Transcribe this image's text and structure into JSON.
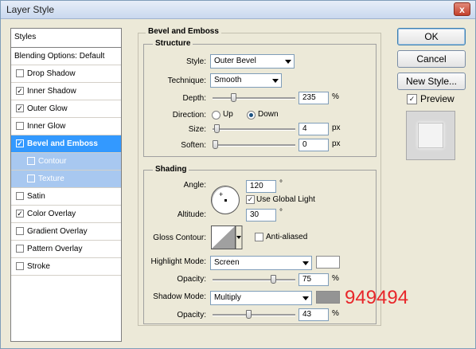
{
  "window": {
    "title": "Layer Style",
    "close_glyph": "x"
  },
  "styles_panel": {
    "header": "Styles",
    "items": [
      {
        "label": "Blending Options: Default",
        "checkbox": false,
        "checked": false,
        "state": "normal"
      },
      {
        "label": "Drop Shadow",
        "checkbox": true,
        "checked": false,
        "state": "normal"
      },
      {
        "label": "Inner Shadow",
        "checkbox": true,
        "checked": true,
        "state": "normal"
      },
      {
        "label": "Outer Glow",
        "checkbox": true,
        "checked": true,
        "state": "normal"
      },
      {
        "label": "Inner Glow",
        "checkbox": true,
        "checked": false,
        "state": "normal"
      },
      {
        "label": "Bevel and Emboss",
        "checkbox": true,
        "checked": true,
        "state": "selected"
      },
      {
        "label": "Contour",
        "checkbox": true,
        "checked": false,
        "state": "sub"
      },
      {
        "label": "Texture",
        "checkbox": true,
        "checked": false,
        "state": "sub"
      },
      {
        "label": "Satin",
        "checkbox": true,
        "checked": false,
        "state": "normal"
      },
      {
        "label": "Color Overlay",
        "checkbox": true,
        "checked": true,
        "state": "normal"
      },
      {
        "label": "Gradient Overlay",
        "checkbox": true,
        "checked": false,
        "state": "normal"
      },
      {
        "label": "Pattern Overlay",
        "checkbox": true,
        "checked": false,
        "state": "normal"
      },
      {
        "label": "Stroke",
        "checkbox": true,
        "checked": false,
        "state": "normal"
      }
    ]
  },
  "bevel": {
    "section_title": "Bevel and Emboss",
    "structure": {
      "title": "Structure",
      "style_label": "Style:",
      "style_value": "Outer Bevel",
      "technique_label": "Technique:",
      "technique_value": "Smooth",
      "depth_label": "Depth:",
      "depth_value": "235",
      "depth_unit": "%",
      "depth_fraction": 0.235,
      "direction_label": "Direction:",
      "direction_up": "Up",
      "direction_down": "Down",
      "direction_selected": "Down",
      "size_label": "Size:",
      "size_value": "4",
      "size_unit": "px",
      "size_fraction": 0.02,
      "soften_label": "Soften:",
      "soften_value": "0",
      "soften_unit": "px",
      "soften_fraction": 0.0
    },
    "shading": {
      "title": "Shading",
      "angle_label": "Angle:",
      "angle_value": "120",
      "angle_unit": "°",
      "global_light_label": "Use Global Light",
      "global_light_checked": true,
      "altitude_label": "Altitude:",
      "altitude_value": "30",
      "altitude_unit": "°",
      "gloss_label": "Gloss Contour:",
      "antialiased_label": "Anti-aliased",
      "antialiased_checked": false,
      "highlight_label": "Highlight Mode:",
      "highlight_mode": "Screen",
      "highlight_color": "#ffffff",
      "highlight_opacity_label": "Opacity:",
      "highlight_opacity_value": "75",
      "highlight_opacity_fraction": 0.75,
      "shadow_label": "Shadow Mode:",
      "shadow_mode": "Multiply",
      "shadow_color": "#949494",
      "shadow_color_text": "949494",
      "shadow_opacity_label": "Opacity:",
      "shadow_opacity_value": "43",
      "shadow_opacity_fraction": 0.43,
      "percent_unit": "%"
    }
  },
  "buttons": {
    "ok": "OK",
    "cancel": "Cancel",
    "new_style": "New Style...",
    "preview_label": "Preview",
    "preview_checked": true
  },
  "colors": {
    "selected_bg": "#3399ff",
    "sub_bg": "#a8c8f0",
    "dialog_bg": "#ece9d8",
    "annotation": "#e8262a"
  }
}
